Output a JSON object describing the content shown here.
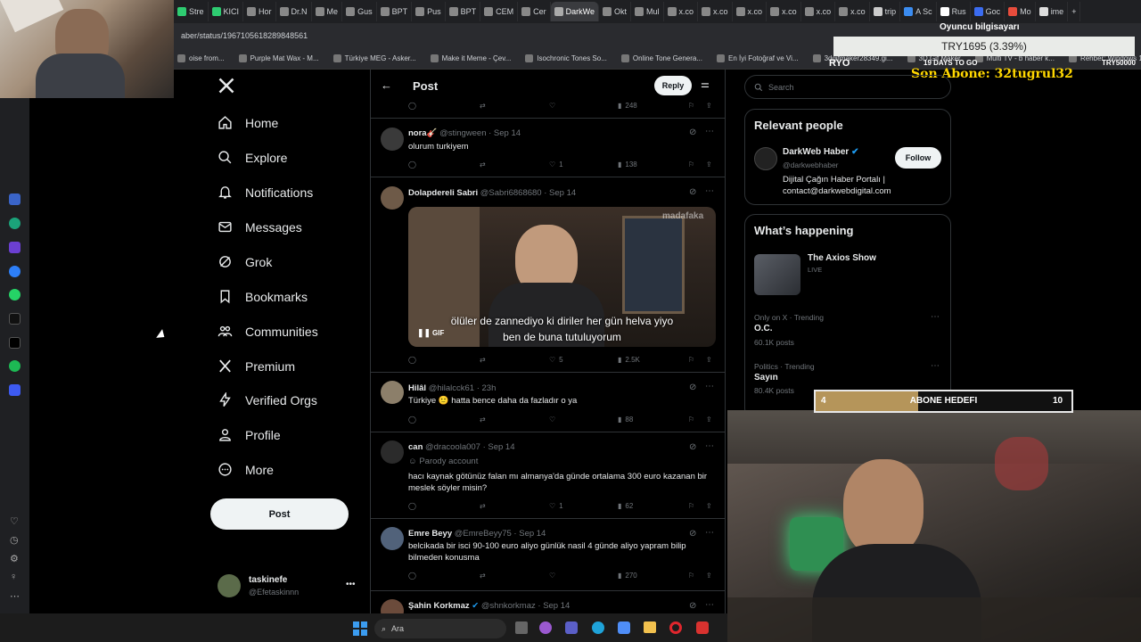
{
  "browser": {
    "tabs": [
      "Stre",
      "KICI",
      "Hor",
      "Dr.N",
      "Me",
      "Gus",
      "BPT",
      "Pus",
      "BPT",
      "CEM",
      "Cer",
      "DarkWe",
      "Okt",
      "Mul",
      "x.co",
      "x.co",
      "x.co",
      "x.co",
      "x.co",
      "x.co",
      "trip",
      "A Sc",
      "Rus",
      "Goc",
      "Mo",
      "ime"
    ],
    "active_tab_index": 11,
    "url": "aber/status/1967105618289848561",
    "bookmarks": [
      "oise from...",
      "Purple Mat Wax - M...",
      "Türkiye MEG - Asker...",
      "Make it Meme - Çev...",
      "Isochronic Tones So...",
      "Online Tone Genera...",
      "En İyi Fotoğraf ve Vi...",
      "3dgifmaker28349.gi...",
      "3D Gif Maker",
      "Multi TV - b haber k...",
      "Rehber: Windows 1..."
    ]
  },
  "overlay": {
    "pc_label": "Oyuncu bilgisayarı",
    "ticker": "TRY1695 (3.39%)",
    "ryo": "RYO",
    "days_to_go": "19 DAYS TO GO",
    "goal": "TRY50000",
    "last_sub": "Son Abone: 32tugrul32",
    "sub_goal_current": "4",
    "sub_goal_label": "ABONE HEDEFI",
    "sub_goal_target": "10",
    "sub_goal_fraction": 0.4
  },
  "nav": {
    "home": "Home",
    "explore": "Explore",
    "notifications": "Notifications",
    "messages": "Messages",
    "grok": "Grok",
    "bookmarks": "Bookmarks",
    "communities": "Communities",
    "premium": "Premium",
    "verified_orgs": "Verified Orgs",
    "profile": "Profile",
    "more": "More",
    "post_button": "Post"
  },
  "account": {
    "name": "taskinefe",
    "handle": "@Efetaskinnn"
  },
  "header": {
    "title": "Post",
    "reply_button": "Reply"
  },
  "top_actions": {
    "views": "248"
  },
  "tweets": [
    {
      "name": "nora🎸",
      "handle": "@stingween · Sep 14",
      "text": "olurum turkiyem",
      "likes": "1",
      "views": "138"
    },
    {
      "name": "Dolapdereli Sabri",
      "handle": "@Sabri6868680 · Sep 14",
      "gif_caption_1": "ölüler de zannediyo ki diriler her gün helva yiyo",
      "gif_caption_2": "ben de buna tutuluyorum",
      "gif_watermark": "madafaka",
      "gif_label": "GIF",
      "likes": "5",
      "views": "2.5K"
    },
    {
      "name": "Hilâl",
      "handle": "@hilalcck61 · 23h",
      "text": "Türkiye 🙂 hatta bence daha da fazladır o ya",
      "likes": "",
      "views": "88"
    },
    {
      "name": "can",
      "handle": "@dracoola007 · Sep 14",
      "badge": "Parody account",
      "text": "hacı kaynak götünüz falan mı almanya'da günde ortalama 300 euro kazanan bir meslek söyler misin?",
      "likes": "1",
      "views": "62"
    },
    {
      "name": "Emre Beyy",
      "handle": "@EmreBeyy75 · Sep 14",
      "text": "belcikada bir isci 90-100 euro aliyo günlük nasil 4 günde aliyo yapram bilip bilmeden konusma",
      "likes": "",
      "views": "270"
    },
    {
      "name": "Şahin Korkmaz",
      "handle": "@shnkorkmaz · Sep 14"
    }
  ],
  "search": {
    "placeholder": "Search"
  },
  "relevant": {
    "title": "Relevant people",
    "name": "DarkWeb Haber",
    "handle": "@darkwebhaber",
    "bio": "Dijital Çağın Haber Portalı | contact@darkwebdigital.com",
    "follow": "Follow"
  },
  "happening": {
    "title": "What’s happening",
    "show_title": "The Axios Show",
    "show_status": "LIVE",
    "trends": [
      {
        "context": "Only on X · Trending",
        "name": "O.C.",
        "posts": "60.1K posts"
      },
      {
        "context": "Politics · Trending",
        "name": "Sayın",
        "posts": "80.4K posts"
      }
    ]
  },
  "taskbar": {
    "search_label": "Ara"
  },
  "colors": {
    "bg": "#000000",
    "border": "#2f3336",
    "muted": "#71767b",
    "accent": "#1d9bf0",
    "overlay_yellow": "#ffd700"
  }
}
